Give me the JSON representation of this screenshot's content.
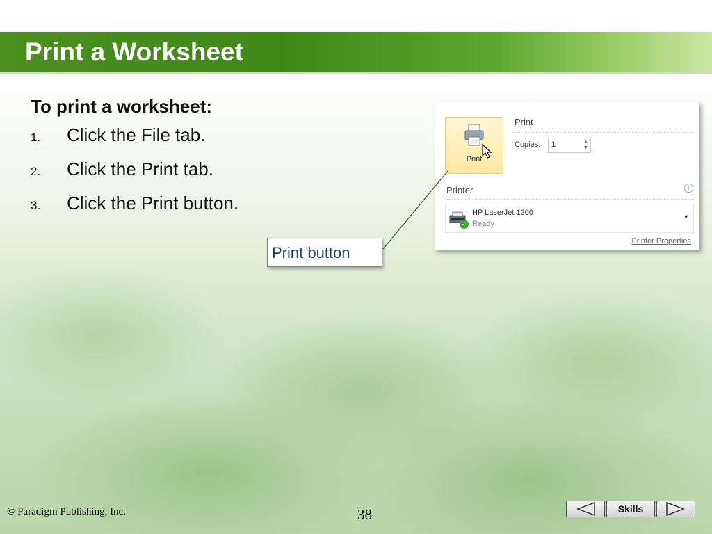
{
  "slide": {
    "title": "Print a Worksheet",
    "intro": "To print a worksheet:",
    "steps": [
      {
        "num": "1.",
        "text": "Click the File tab."
      },
      {
        "num": "2.",
        "text": "Click the Print tab."
      },
      {
        "num": "3.",
        "text": "Click the Print button."
      }
    ],
    "callout": "Print button"
  },
  "screenshot": {
    "print_button_label": "Print",
    "print_header": "Print",
    "copies_label": "Copies:",
    "copies_value": "1",
    "printer_header": "Printer",
    "printer_name": "HP LaserJet 1200",
    "printer_status": "Ready",
    "printer_properties": "Printer Properties"
  },
  "footer": {
    "copyright": "© Paradigm Publishing, Inc.",
    "page_number": "38",
    "nav_label": "Skills"
  },
  "colors": {
    "title_bar": "#3f8818",
    "callout_text": "#1f3a6e"
  },
  "icons": [
    "printer-icon",
    "cursor-icon",
    "info-icon",
    "printer-device-icon",
    "ready-check-icon",
    "dropdown-arrow-icon",
    "prev-arrow-icon",
    "next-arrow-icon"
  ]
}
